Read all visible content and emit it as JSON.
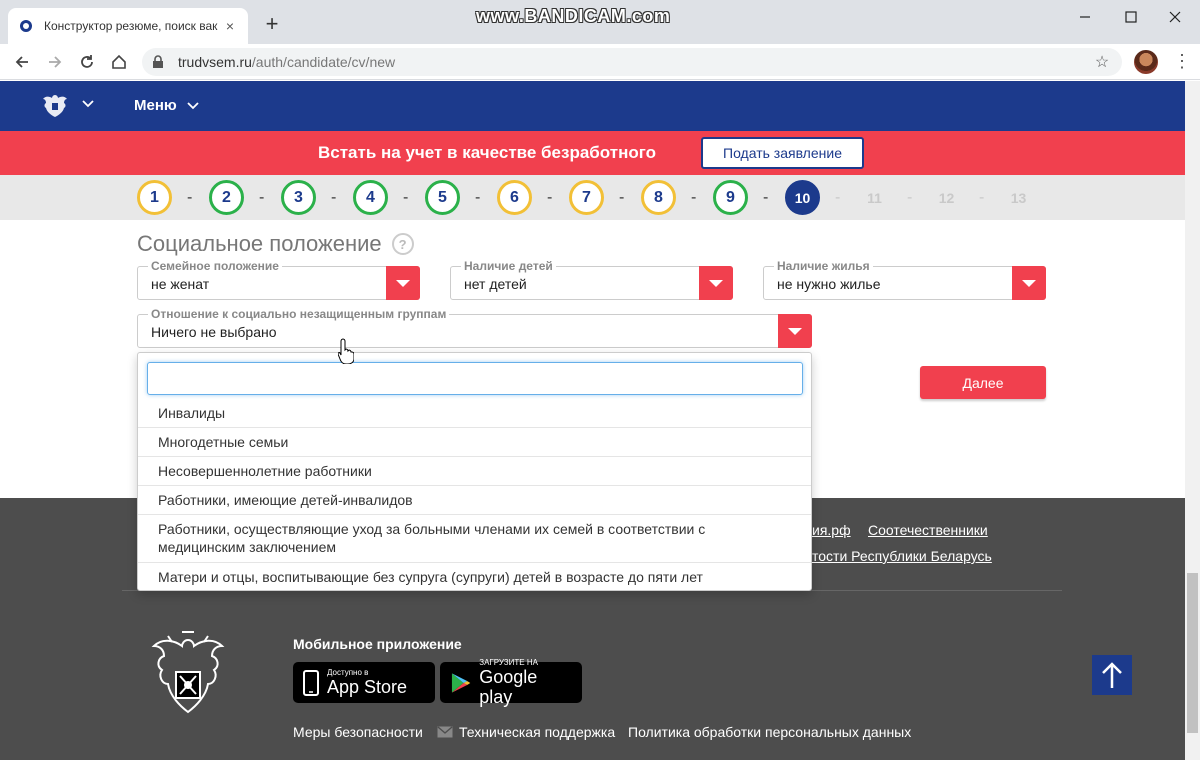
{
  "browser": {
    "tab_title": "Конструктор резюме, поиск вак",
    "tab_close": "×",
    "new_tab": "+",
    "watermark": "www.BANDICAM.com",
    "url_host": "trudvsem.ru",
    "url_path": "/auth/candidate/cv/new"
  },
  "header": {
    "menu_label": "Меню"
  },
  "banner": {
    "text": "Встать на учет в качестве безработного",
    "button": "Подать заявление"
  },
  "steps": {
    "items": [
      "1",
      "2",
      "3",
      "4",
      "5",
      "6",
      "7",
      "8",
      "9",
      "10",
      "11",
      "12",
      "13"
    ],
    "states": [
      "y",
      "g",
      "g",
      "g",
      "g",
      "y",
      "y",
      "y",
      "g",
      "active",
      "future",
      "future",
      "future"
    ],
    "separator": "-"
  },
  "form": {
    "section_title": "Социальное положение",
    "help": "?",
    "family": {
      "label": "Семейное положение",
      "value": "не женат"
    },
    "children": {
      "label": "Наличие детей",
      "value": "нет детей"
    },
    "housing": {
      "label": "Наличие жилья",
      "value": "не нужно жилье"
    },
    "social": {
      "label": "Отношение к социально незащищенным группам",
      "value": "Ничего не выбрано"
    },
    "next_button": "Далее"
  },
  "dropdown": {
    "search_value": "",
    "options": [
      "Инвалиды",
      "Многодетные семьи",
      "Несовершеннолетние работники",
      "Работники, имеющие детей-инвалидов",
      "Работники, осуществляющие уход за больными членами их семей в соответствии с медицинским заключением",
      "Матери и отцы, воспитывающие без супруга (супруги) детей в возрасте до пяти лет"
    ]
  },
  "footer": {
    "link_partial_1": "ия.рф",
    "link_compatriots": "Соотечественники",
    "link_partial_2": "тости Республики Беларусь",
    "mobile_title": "Мобильное приложение",
    "appstore_small": "Доступно в",
    "appstore_big": "App Store",
    "google_small": "ЗАГРУЗИТЕ НА",
    "google_big": "Google play",
    "security": "Меры безопасности",
    "support": "Техническая поддержка",
    "privacy": "Политика обработки персональных данных"
  },
  "colors": {
    "brand_blue": "#1c3a8c",
    "brand_red": "#f1404e",
    "step_yellow": "#f2c037",
    "step_green": "#2bb14a",
    "footer_bg": "#4d4d4d"
  }
}
